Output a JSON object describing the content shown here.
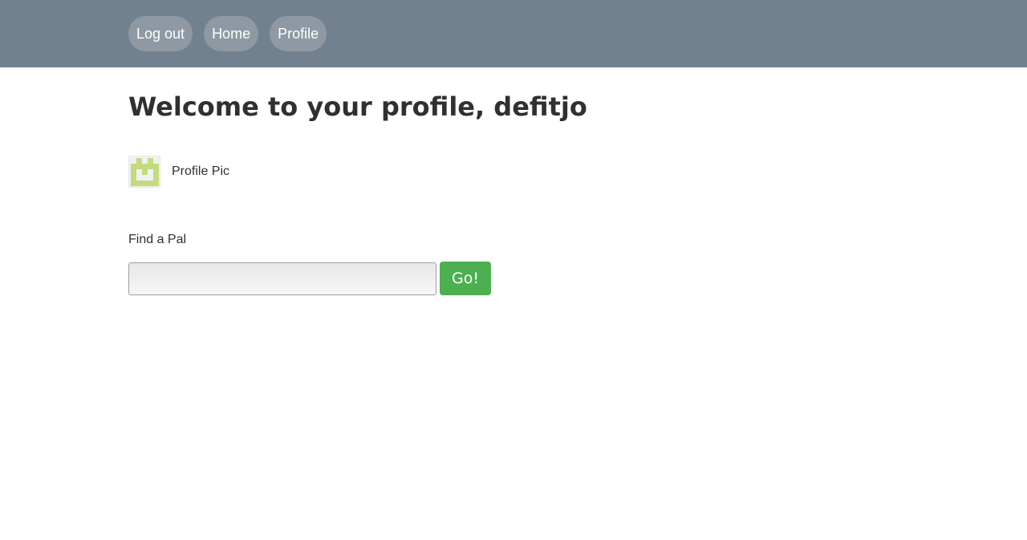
{
  "nav": {
    "items": [
      {
        "label": "Log out"
      },
      {
        "label": "Home"
      },
      {
        "label": "Profile"
      }
    ]
  },
  "main": {
    "title": "Welcome to your profile, defitjo",
    "profile_pic_label": "Profile Pic",
    "find_pal_label": "Find a Pal",
    "search_value": "",
    "go_button_label": "Go!"
  },
  "colors": {
    "topbar": "#72818f",
    "nav_button": "#8e99a4",
    "go_button": "#4caf50",
    "avatar_pattern": "#c3db7d"
  }
}
